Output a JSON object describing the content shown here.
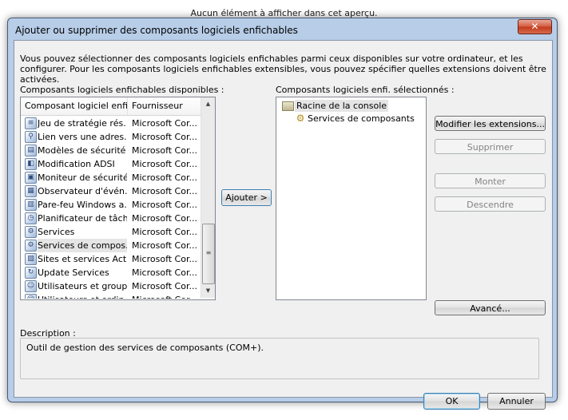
{
  "background_text": "Aucun élément à afficher dans cet aperçu.",
  "dialog": {
    "title": "Ajouter ou supprimer des composants logiciels enfichables",
    "close_glyph": "✕",
    "intro": "Vous pouvez sélectionner des composants logiciels enfichables parmi ceux disponibles sur votre ordinateur, et les configurer. Pour les composants logiciels enfichables extensibles, vous pouvez spécifier quelles extensions doivent être activées.",
    "available_label": "Composants logiciels enfichables disponibles :",
    "selected_label": "Composants logiciels enfi. sélectionnés :",
    "columns": {
      "name": "Composant logiciel enfi...",
      "vendor": "Fournisseur"
    },
    "available_items": [
      {
        "name": "Jeu de stratégie rés...",
        "vendor": "Microsoft Cor...",
        "icon": "policy-icon",
        "glyph": "≡"
      },
      {
        "name": "Lien vers une adres...",
        "vendor": "Microsoft Cor...",
        "icon": "link-icon",
        "glyph": "⚲"
      },
      {
        "name": "Modèles de sécurité",
        "vendor": "Microsoft Cor...",
        "icon": "security-template-icon",
        "glyph": "▤"
      },
      {
        "name": "Modification ADSI",
        "vendor": "Microsoft Cor...",
        "icon": "adsi-icon",
        "glyph": "◧"
      },
      {
        "name": "Moniteur de sécurité...",
        "vendor": "Microsoft Cor...",
        "icon": "security-monitor-icon",
        "glyph": "▣"
      },
      {
        "name": "Observateur d'évén...",
        "vendor": "Microsoft Cor...",
        "icon": "event-viewer-icon",
        "glyph": "▦"
      },
      {
        "name": "Pare-feu Windows a...",
        "vendor": "Microsoft Cor...",
        "icon": "firewall-icon",
        "glyph": "▥"
      },
      {
        "name": "Planificateur de tâches",
        "vendor": "Microsoft Cor...",
        "icon": "clock-icon",
        "glyph": "◷"
      },
      {
        "name": "Services",
        "vendor": "Microsoft Cor...",
        "icon": "services-icon",
        "glyph": "⚙"
      },
      {
        "name": "Services de compos...",
        "vendor": "Microsoft Cor...",
        "icon": "component-services-icon",
        "glyph": "⚙"
      },
      {
        "name": "Sites et services Act...",
        "vendor": "Microsoft Cor...",
        "icon": "sites-icon",
        "glyph": "▧"
      },
      {
        "name": "Update Services",
        "vendor": "Microsoft Cor...",
        "icon": "update-icon",
        "glyph": "↻"
      },
      {
        "name": "Utilisateurs et group...",
        "vendor": "Microsoft Cor...",
        "icon": "users-icon",
        "glyph": "☺"
      },
      {
        "name": "Utilisateurs et ordin...",
        "vendor": "Microsoft Cor...",
        "icon": "users-computers-icon",
        "glyph": "☺"
      }
    ],
    "selected_index": 9,
    "add_button": "Ajouter >",
    "tree": {
      "root": "Racine de la console",
      "child": "Services de composants"
    },
    "buttons": {
      "edit_extensions": "Modifier les extensions...",
      "remove": "Supprimer",
      "move_up": "Monter",
      "move_down": "Descendre",
      "advanced": "Avancé...",
      "ok": "OK",
      "cancel": "Annuler"
    },
    "description_label": "Description :",
    "description_text": "Outil de gestion des services de composants (COM+)."
  }
}
